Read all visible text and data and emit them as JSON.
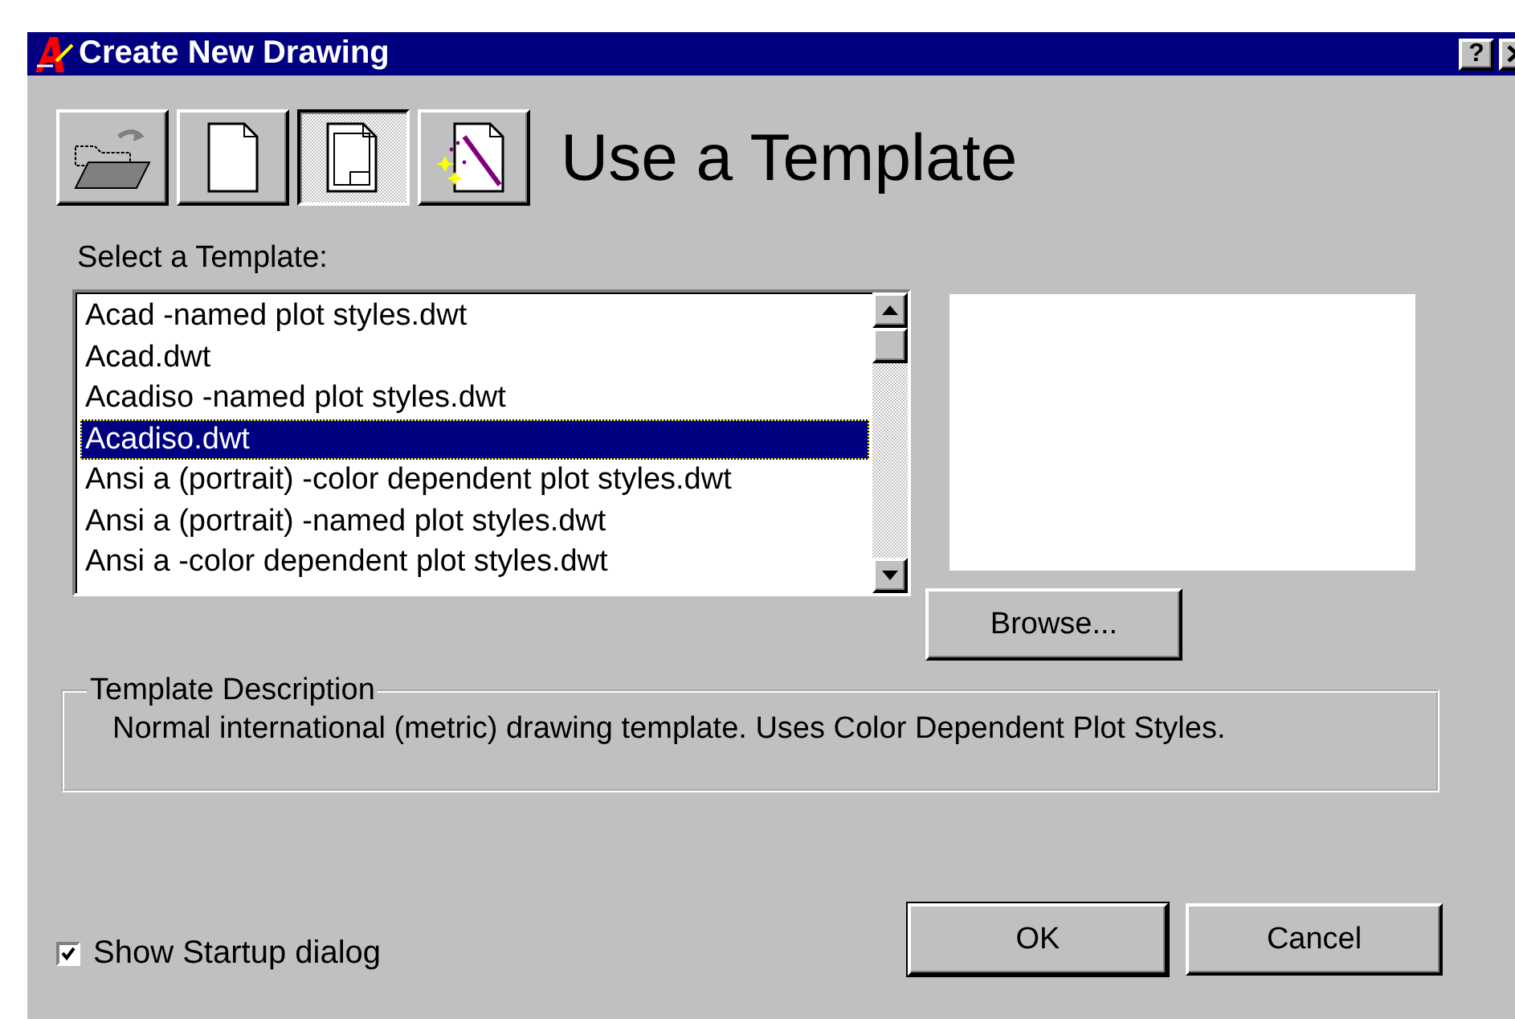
{
  "window": {
    "title": "Create New Drawing",
    "help_button": "?"
  },
  "modes": [
    {
      "kind": "open",
      "selected": false
    },
    {
      "kind": "scratch",
      "selected": false
    },
    {
      "kind": "template",
      "selected": true
    },
    {
      "kind": "wizard",
      "selected": false
    }
  ],
  "heading": "Use a Template",
  "list_label": "Select a Template:",
  "templates": [
    {
      "label": "Acad -named plot styles.dwt",
      "selected": false
    },
    {
      "label": "Acad.dwt",
      "selected": false
    },
    {
      "label": "Acadiso -named plot styles.dwt",
      "selected": false
    },
    {
      "label": "Acadiso.dwt",
      "selected": true
    },
    {
      "label": "Ansi a (portrait) -color dependent plot styles.dwt",
      "selected": false
    },
    {
      "label": "Ansi a (portrait) -named plot styles.dwt",
      "selected": false
    },
    {
      "label": "Ansi a -color dependent plot styles.dwt",
      "selected": false
    }
  ],
  "browse_button": "Browse...",
  "description": {
    "legend": "Template Description",
    "text": "Normal international (metric) drawing template. Uses Color Dependent Plot Styles."
  },
  "show_startup": {
    "label": "Show Startup dialog",
    "checked": true
  },
  "buttons": [
    "OK",
    "Cancel"
  ]
}
